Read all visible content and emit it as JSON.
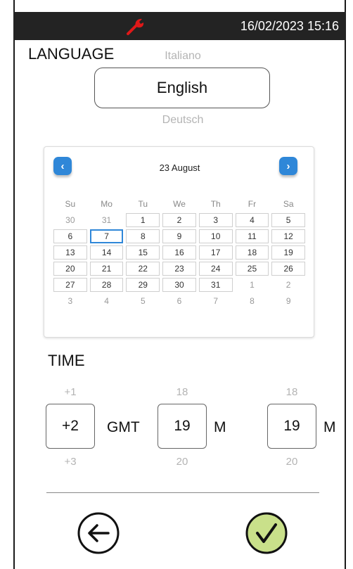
{
  "status_bar": {
    "datetime": "16/02/2023 15:16",
    "icon": "wrench-icon"
  },
  "language": {
    "title": "LANGUAGE",
    "previous": "Italiano",
    "selected": "English",
    "next": "Deutsch"
  },
  "calendar": {
    "title": "23 August",
    "prev_icon": "‹",
    "next_icon": "›",
    "weekdays": [
      "Su",
      "Mo",
      "Tu",
      "We",
      "Th",
      "Fr",
      "Sa"
    ],
    "weeks": [
      [
        "30",
        "31",
        "1",
        "2",
        "3",
        "4",
        "5"
      ],
      [
        "6",
        "7",
        "8",
        "9",
        "10",
        "11",
        "12"
      ],
      [
        "13",
        "14",
        "15",
        "16",
        "17",
        "18",
        "19"
      ],
      [
        "20",
        "21",
        "22",
        "23",
        "24",
        "25",
        "26"
      ],
      [
        "27",
        "28",
        "29",
        "30",
        "31",
        "1",
        "2"
      ],
      [
        "3",
        "4",
        "5",
        "6",
        "7",
        "8",
        "9"
      ]
    ],
    "selected_day": "7"
  },
  "time": {
    "title": "TIME",
    "gmt": {
      "previous": "+1",
      "value": "+2",
      "next": "+3",
      "unit": "GMT"
    },
    "field2": {
      "previous": "18",
      "value": "19",
      "next": "20",
      "unit": "M"
    },
    "field3": {
      "previous": "18",
      "value": "19",
      "next": "20",
      "unit": "M"
    }
  },
  "colors": {
    "accent": "#2f87d8",
    "confirm": "#6a8f2a",
    "confirm_bg": "#c9e08a",
    "wrench": "#e01818",
    "statusbar": "#232323"
  }
}
